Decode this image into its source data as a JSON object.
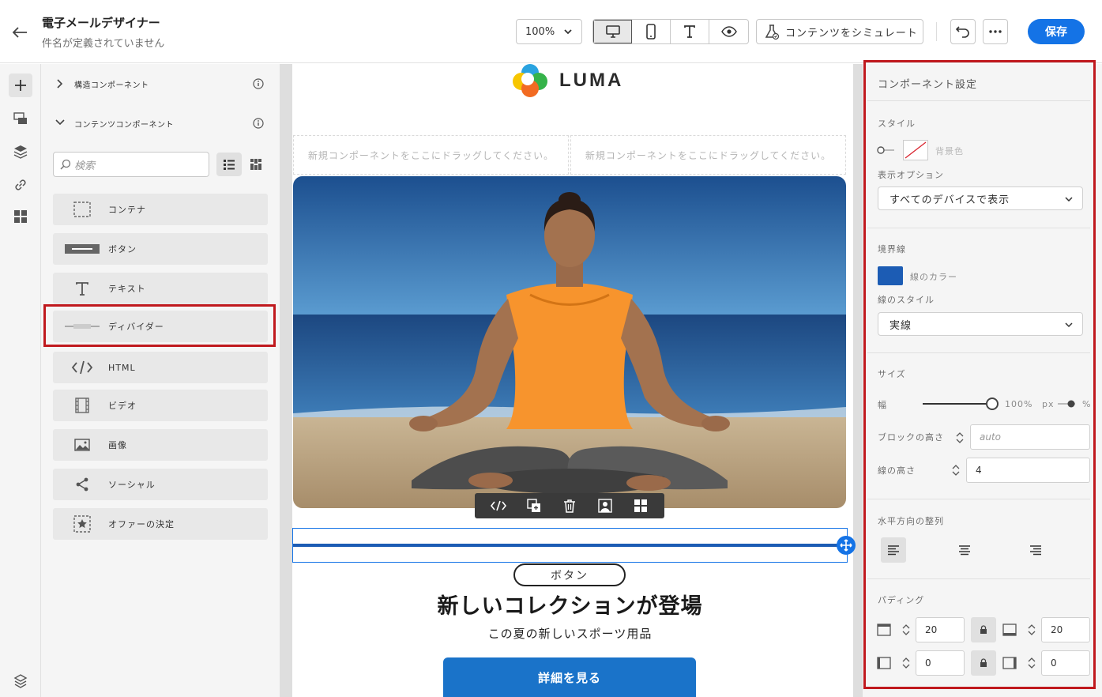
{
  "header": {
    "title": "電子メールデザイナー",
    "subtitle": "件名が定義されていません",
    "zoom": "100%",
    "simulate_label": "コンテンツをシミュレート",
    "save_label": "保存"
  },
  "components_panel": {
    "structure_section": "構造コンポーネント",
    "content_section": "コンテンツコンポーネント",
    "search_placeholder": "検索",
    "items": [
      {
        "label": "コンテナ",
        "icon": "container-icon"
      },
      {
        "label": "ボタン",
        "icon": "button-icon"
      },
      {
        "label": "テキスト",
        "icon": "text-icon"
      },
      {
        "label": "ディバイダー",
        "icon": "divider-icon"
      },
      {
        "label": "HTML",
        "icon": "html-icon"
      },
      {
        "label": "ビデオ",
        "icon": "video-icon"
      },
      {
        "label": "画像",
        "icon": "image-icon"
      },
      {
        "label": "ソーシャル",
        "icon": "social-icon"
      },
      {
        "label": "オファーの決定",
        "icon": "offer-icon"
      }
    ]
  },
  "canvas": {
    "logo_text": "LUMA",
    "dropzone_text": "新規コンポーネントをここにドラッグしてください。",
    "button_pill": "ボタン",
    "headline": "新しいコレクションが登場",
    "subline": "この夏の新しいスポーツ用品",
    "cta": "詳細を見る"
  },
  "settings": {
    "title": "コンポーネント設定",
    "style_label": "スタイル",
    "background_label": "背景色",
    "display_options_label": "表示オプション",
    "display_options_value": "すべてのデバイスで表示",
    "border_label": "境界線",
    "line_color_label": "線のカラー",
    "line_color": "#1c5cb4",
    "line_style_label": "線のスタイル",
    "line_style_value": "実線",
    "size_label": "サイズ",
    "width_label": "幅",
    "width_value": "100%",
    "unit_px": "px",
    "unit_pct": "%",
    "block_height_label": "ブロックの高さ",
    "block_height_value": "auto",
    "line_height_label": "線の高さ",
    "line_height_value": "4",
    "h_align_label": "水平方向の整列",
    "padding_label": "パディング",
    "padding_top": "20",
    "padding_bottom": "20",
    "padding_left": "0",
    "padding_right": "0"
  },
  "colors": {
    "accent": "#1473e6",
    "highlight": "#c0191e",
    "divider": "#1c5cb4"
  }
}
